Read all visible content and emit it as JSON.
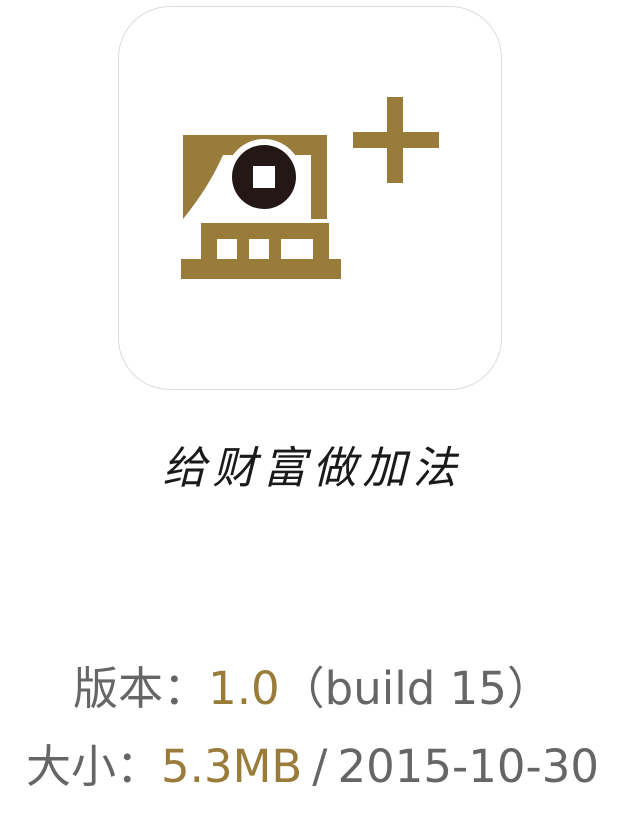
{
  "app": {
    "icon_name": "ying-plus-logo-icon",
    "logo_char": "盈",
    "tagline": "给财富做加法",
    "brand_color": "#9a7c3a"
  },
  "version": {
    "label": "版本：",
    "value": "1.0",
    "build": "（build 15）"
  },
  "size": {
    "label": "大小：",
    "value": "5.3MB",
    "separator": "/",
    "date": "2015-10-30"
  },
  "colors": {
    "gold": "#9a7c3a",
    "text_gray": "#666666",
    "coin_dark": "#231815"
  }
}
